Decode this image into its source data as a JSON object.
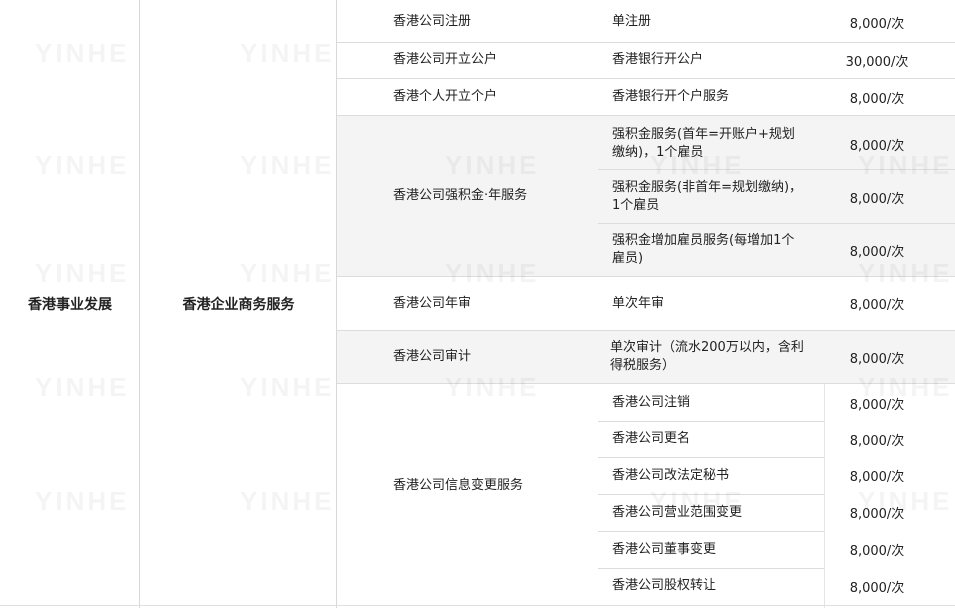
{
  "watermark_text": "YINHE",
  "table": {
    "level1": "香港事业发展",
    "level2": "香港企业商务服务",
    "rows": [
      {
        "service": "香港公司注册",
        "item": "单注册",
        "price": "8,000/次"
      },
      {
        "service": "香港公司开立公户",
        "item": "香港银行开公户",
        "price": "30,000/次"
      },
      {
        "service": "香港个人开立个户",
        "item": "香港银行开个户服务",
        "price": "8,000/次"
      },
      {
        "service": "香港公司强积金·年服务",
        "items": [
          {
            "item": "强积金服务(首年=开账户+规划缴纳)，1个雇员",
            "price": "8,000/次"
          },
          {
            "item": "强积金服务(非首年=规划缴纳)，1个雇员",
            "price": "8,000/次"
          },
          {
            "item": "强积金增加雇员服务(每增加1个雇员)",
            "price": "8,000/次"
          }
        ]
      },
      {
        "service": "香港公司年审",
        "item": "单次年审",
        "price": "8,000/次"
      },
      {
        "service": "香港公司审计",
        "item": "单次审计（流水200万以内，含利得税服务）",
        "price": "8,000/次"
      },
      {
        "service": "香港公司信息变更服务",
        "items": [
          {
            "item": "香港公司注销",
            "price": "8,000/次"
          },
          {
            "item": "香港公司更名",
            "price": "8,000/次"
          },
          {
            "item": "香港公司改法定秘书",
            "price": "8,000/次"
          },
          {
            "item": "香港公司营业范围变更",
            "price": "8,000/次"
          },
          {
            "item": "香港公司董事变更",
            "price": "8,000/次"
          },
          {
            "item": "香港公司股权转让",
            "price": "8,000/次"
          }
        ]
      }
    ]
  }
}
